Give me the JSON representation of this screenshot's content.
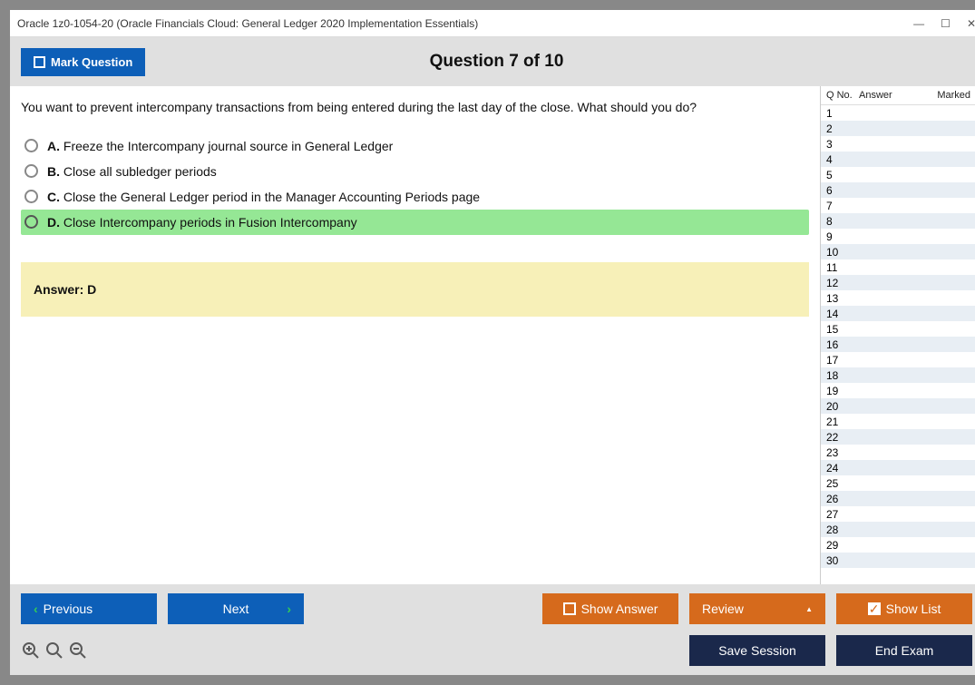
{
  "window": {
    "title": "Oracle 1z0-1054-20 (Oracle Financials Cloud: General Ledger 2020 Implementation Essentials)"
  },
  "header": {
    "mark_label": "Mark Question",
    "counter": "Question 7 of 10"
  },
  "question": {
    "text": "You want to prevent intercompany transactions from being entered during the last day of the close. What should you do?",
    "options": [
      {
        "letter": "A.",
        "text": "Freeze the Intercompany journal source in General Ledger",
        "selected": false
      },
      {
        "letter": "B.",
        "text": "Close all subledger periods",
        "selected": false
      },
      {
        "letter": "C.",
        "text": "Close the General Ledger period in the Manager Accounting Periods page",
        "selected": false
      },
      {
        "letter": "D.",
        "text": "Close Intercompany periods in Fusion Intercompany",
        "selected": true
      }
    ],
    "answer_label": "Answer: D"
  },
  "sidebar": {
    "col1": "Q No.",
    "col2": "Answer",
    "col3": "Marked",
    "row_count": 30
  },
  "footer": {
    "previous": "Previous",
    "next": "Next",
    "show_answer": "Show Answer",
    "review": "Review",
    "show_list": "Show List",
    "save_session": "Save Session",
    "end_exam": "End Exam"
  }
}
